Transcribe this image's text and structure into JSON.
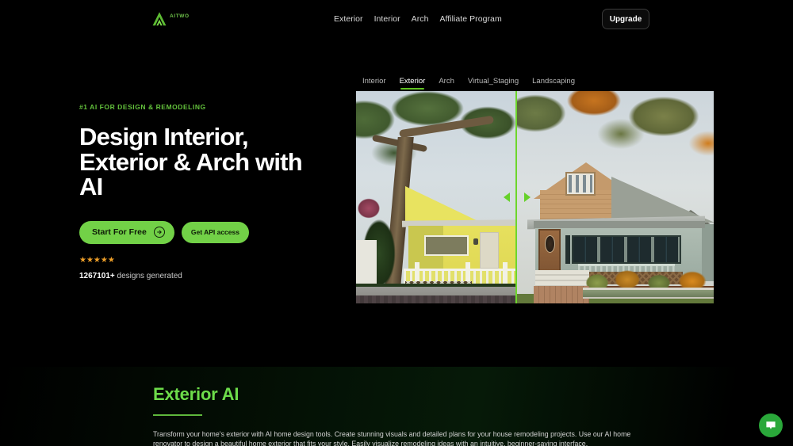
{
  "header": {
    "brand": {
      "word": "AITWO",
      "icon": "arch-logo-icon"
    },
    "nav": [
      {
        "label": "Exterior"
      },
      {
        "label": "Interior"
      },
      {
        "label": "Arch"
      },
      {
        "label": "Affiliate Program"
      }
    ],
    "upgrade_label": "Upgrade"
  },
  "hero": {
    "eyebrow": "#1 AI FOR DESIGN & REMODELING",
    "title": "Design Interior, Exterior & Arch with AI",
    "primary_cta": "Start For Free",
    "secondary_cta": "Get API access",
    "stars": "★★★★★",
    "stars_count": 5,
    "designs_count": "1267101+",
    "designs_label": " designs generated"
  },
  "showcase": {
    "tabs": [
      {
        "label": "Interior",
        "active": false
      },
      {
        "label": "Exterior",
        "active": true
      },
      {
        "label": "Arch",
        "active": false
      },
      {
        "label": "Virtual_Staging",
        "active": false
      },
      {
        "label": "Landscaping",
        "active": false
      }
    ],
    "slider_position_pct": 45,
    "before_alt": "Yellow bungalow house before AI remodel",
    "after_alt": "Craftsman bungalow house after AI remodel"
  },
  "section": {
    "title": "Exterior AI",
    "body": "Transform your home's exterior with AI home design tools. Create stunning visuals and detailed plans for your house remodeling projects. Use our AI home renovator to design a beautiful home exterior that fits your style. Easily visualize remodeling ideas with an intuitive, beginner-saving interface."
  },
  "chat": {
    "icon": "chat-bubble-icon"
  },
  "colors": {
    "accent_green": "#72d147",
    "accent_green_bright": "#6ddc4a",
    "tab_underline": "#61c322",
    "star_gold": "#f0a029",
    "chat_green": "#2aa83a",
    "background": "#000000"
  }
}
